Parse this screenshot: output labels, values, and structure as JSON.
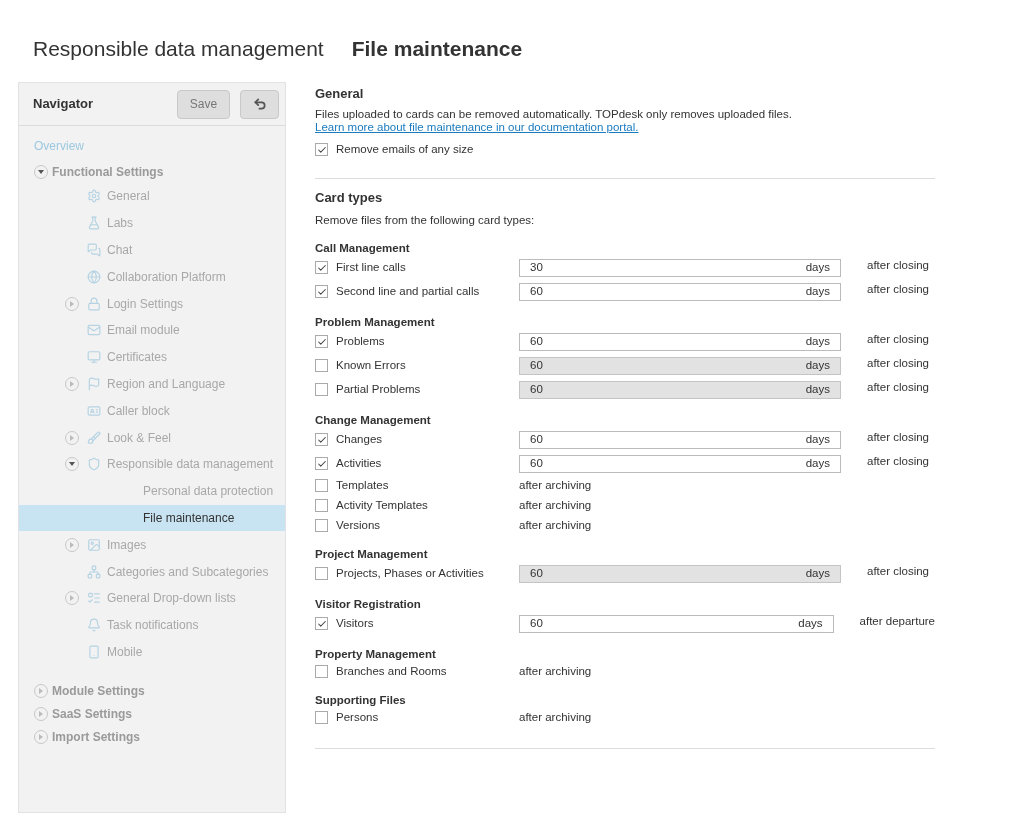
{
  "page_title": {
    "section": "Responsible data management",
    "page": "File maintenance"
  },
  "navigator": {
    "title": "Navigator",
    "save_button": "Save",
    "items": [
      {
        "label": "Overview",
        "kind": "link",
        "selected": false
      },
      {
        "label": "Functional Settings",
        "kind": "section",
        "expanded": true,
        "selected": false,
        "children": [
          {
            "label": "General",
            "selected": false
          },
          {
            "label": "Labs",
            "selected": false
          },
          {
            "label": "Chat",
            "selected": false
          },
          {
            "label": "Collaboration Platform",
            "selected": false
          },
          {
            "label": "Login Settings",
            "expanded": false,
            "selected": false
          },
          {
            "label": "Email module",
            "selected": false
          },
          {
            "label": "Certificates",
            "selected": false
          },
          {
            "label": "Region and Language",
            "expanded": false,
            "selected": false
          },
          {
            "label": "Caller block",
            "selected": false
          },
          {
            "label": "Look & Feel",
            "expanded": false,
            "selected": false
          },
          {
            "label": "Responsible data management",
            "expanded": true,
            "selected": false,
            "children": [
              {
                "label": "Personal data protection",
                "selected": false
              },
              {
                "label": "File maintenance",
                "selected": true
              }
            ]
          },
          {
            "label": "Images",
            "expanded": false,
            "selected": false
          },
          {
            "label": "Categories and Subcategories",
            "selected": false
          },
          {
            "label": "General Drop-down lists",
            "expanded": false,
            "selected": false
          },
          {
            "label": "Task notifications",
            "selected": false
          },
          {
            "label": "Mobile",
            "selected": false
          }
        ]
      },
      {
        "label": "Module Settings",
        "kind": "section",
        "expanded": false,
        "selected": false
      },
      {
        "label": "SaaS Settings",
        "kind": "section",
        "expanded": false,
        "selected": false
      },
      {
        "label": "Import Settings",
        "kind": "section",
        "expanded": false,
        "selected": false
      }
    ]
  },
  "general": {
    "heading": "General",
    "description": "Files uploaded to cards can be removed automatically. TOPdesk only removes uploaded files.",
    "link": "Learn more about file maintenance in our documentation portal.",
    "option": {
      "label": "Remove emails of any size",
      "checked": true
    }
  },
  "card_types": {
    "heading": "Card types",
    "description": "Remove files from the following card types:",
    "groups": [
      {
        "title": "Call Management",
        "rows": [
          {
            "kind": "days",
            "label": "First line calls",
            "checked": true,
            "value": "30",
            "unit": "days",
            "suffix": "after closing"
          },
          {
            "kind": "days",
            "label": "Second line and partial calls",
            "checked": true,
            "value": "60",
            "unit": "days",
            "suffix": "after closing"
          }
        ]
      },
      {
        "title": "Problem Management",
        "rows": [
          {
            "kind": "days",
            "label": "Problems",
            "checked": true,
            "value": "60",
            "unit": "days",
            "suffix": "after closing"
          },
          {
            "kind": "days",
            "label": "Known Errors",
            "checked": false,
            "value": "60",
            "unit": "days",
            "suffix": "after closing"
          },
          {
            "kind": "days",
            "label": "Partial Problems",
            "checked": false,
            "value": "60",
            "unit": "days",
            "suffix": "after closing"
          }
        ]
      },
      {
        "title": "Change Management",
        "rows": [
          {
            "kind": "days",
            "label": "Changes",
            "checked": true,
            "value": "60",
            "unit": "days",
            "suffix": "after closing"
          },
          {
            "kind": "days",
            "label": "Activities",
            "checked": true,
            "value": "60",
            "unit": "days",
            "suffix": "after closing"
          },
          {
            "kind": "archive",
            "label": "Templates",
            "checked": false,
            "suffix": "after archiving"
          },
          {
            "kind": "archive",
            "label": "Activity Templates",
            "checked": false,
            "suffix": "after archiving"
          },
          {
            "kind": "archive",
            "label": "Versions",
            "checked": false,
            "suffix": "after archiving"
          }
        ]
      },
      {
        "title": "Project Management",
        "rows": [
          {
            "kind": "days",
            "label": "Projects, Phases or Activities",
            "checked": false,
            "value": "60",
            "unit": "days",
            "suffix": "after closing"
          }
        ]
      },
      {
        "title": "Visitor Registration",
        "rows": [
          {
            "kind": "days",
            "label": "Visitors",
            "checked": true,
            "value": "60",
            "unit": "days",
            "suffix": "after departure"
          }
        ]
      },
      {
        "title": "Property Management",
        "rows": [
          {
            "kind": "archive",
            "label": "Branches and Rooms",
            "checked": false,
            "suffix": "after archiving"
          }
        ]
      },
      {
        "title": "Supporting Files",
        "rows": [
          {
            "kind": "archive",
            "label": "Persons",
            "checked": false,
            "suffix": "after archiving"
          }
        ]
      }
    ]
  }
}
